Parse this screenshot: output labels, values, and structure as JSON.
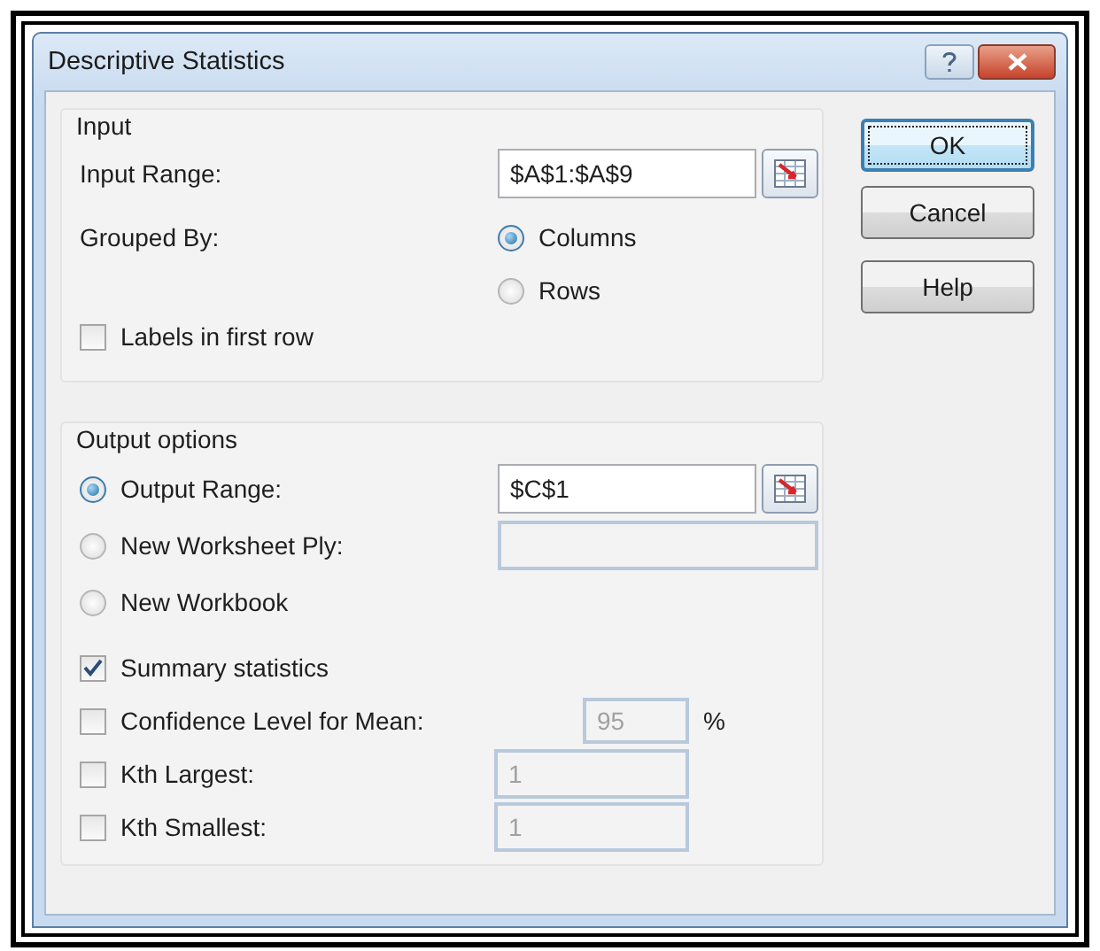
{
  "window": {
    "title": "Descriptive Statistics"
  },
  "input": {
    "label": "Input",
    "input_range": {
      "label": "Input Range:",
      "value": "$A$1:$A$9"
    },
    "grouped_by": {
      "label": "Grouped By:",
      "options": [
        {
          "label": "Columns",
          "selected": true
        },
        {
          "label": "Rows",
          "selected": false
        }
      ]
    },
    "labels_in_first_row": {
      "label": "Labels in first row",
      "checked": false
    }
  },
  "output": {
    "label": "Output options",
    "destinations": [
      {
        "kind": "range",
        "label": "Output Range:",
        "selected": true,
        "value": "$C$1"
      },
      {
        "kind": "text",
        "label": "New Worksheet Ply:",
        "selected": false
      },
      {
        "kind": "plain",
        "label": "New Workbook",
        "selected": false
      }
    ],
    "statistics": [
      {
        "kind": "plain",
        "label": "Summary statistics",
        "checked": true
      },
      {
        "kind": "percent",
        "label": "Confidence Level for Mean:",
        "checked": false,
        "value": "95",
        "disabled": true,
        "unit": "%"
      },
      {
        "kind": "number",
        "label": "Kth Largest:",
        "checked": false,
        "value": "1",
        "disabled": true
      },
      {
        "kind": "number",
        "label": "Kth Smallest:",
        "checked": false,
        "value": "1",
        "disabled": true
      }
    ]
  },
  "buttons": [
    {
      "label": "OK",
      "default": true
    },
    {
      "label": "Cancel",
      "default": false
    },
    {
      "label": "Help",
      "default": false
    }
  ]
}
